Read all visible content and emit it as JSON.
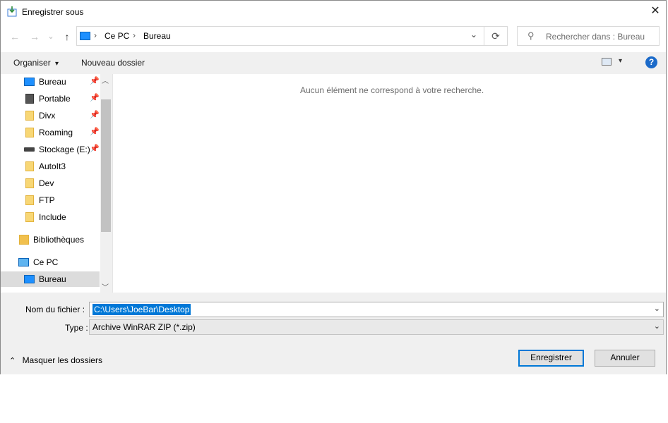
{
  "window": {
    "title": "Enregistrer sous",
    "close_glyph": "✕"
  },
  "nav": {
    "back_glyph": "←",
    "forward_glyph": "→",
    "recent_glyph": "⌄",
    "up_glyph": "↑",
    "breadcrumb": [
      "Ce PC",
      "Bureau"
    ],
    "sep_glyph": "›",
    "dropdown_glyph": "⌄",
    "refresh_glyph": "⟳",
    "search_placeholder": "Rechercher dans : Bureau"
  },
  "toolbar": {
    "organize_label": "Organiser",
    "organize_arrow": "▾",
    "new_folder_label": "Nouveau dossier",
    "view_arrow": "▾",
    "help_label": "?"
  },
  "navpane": {
    "items": [
      {
        "label": "Bureau",
        "icon": "monitor-icon",
        "pinned": true
      },
      {
        "label": "Portable",
        "icon": "document-icon",
        "pinned": true
      },
      {
        "label": "Divx",
        "icon": "folder-icon",
        "pinned": true
      },
      {
        "label": "Roaming",
        "icon": "folder-icon",
        "pinned": true
      },
      {
        "label": "Stockage (E:)",
        "icon": "drive-icon",
        "pinned": true
      },
      {
        "label": "AutoIt3",
        "icon": "folder-icon",
        "pinned": false
      },
      {
        "label": "Dev",
        "icon": "folder-icon",
        "pinned": false
      },
      {
        "label": "FTP",
        "icon": "folder-icon",
        "pinned": false
      },
      {
        "label": "Include",
        "icon": "folder-icon",
        "pinned": false
      }
    ],
    "libraries_label": "Bibliothèques",
    "this_pc_label": "Ce PC",
    "selected_label": "Bureau",
    "pin_glyph": "📌"
  },
  "main": {
    "empty_message": "Aucun élément ne correspond à votre recherche."
  },
  "form": {
    "filename_label": "Nom du fichier :",
    "filename_value": "C:\\Users\\JoeBar\\Desktop",
    "type_label": "Type :",
    "type_value": "Archive WinRAR ZIP (*.zip)",
    "combo_arrow": "⌄"
  },
  "footer": {
    "hide_folders_label": "Masquer les dossiers",
    "hide_glyph": "⌃",
    "save_label": "Enregistrer",
    "cancel_label": "Annuler"
  },
  "colors": {
    "accent": "#0078d7",
    "help": "#1b6ac9"
  }
}
